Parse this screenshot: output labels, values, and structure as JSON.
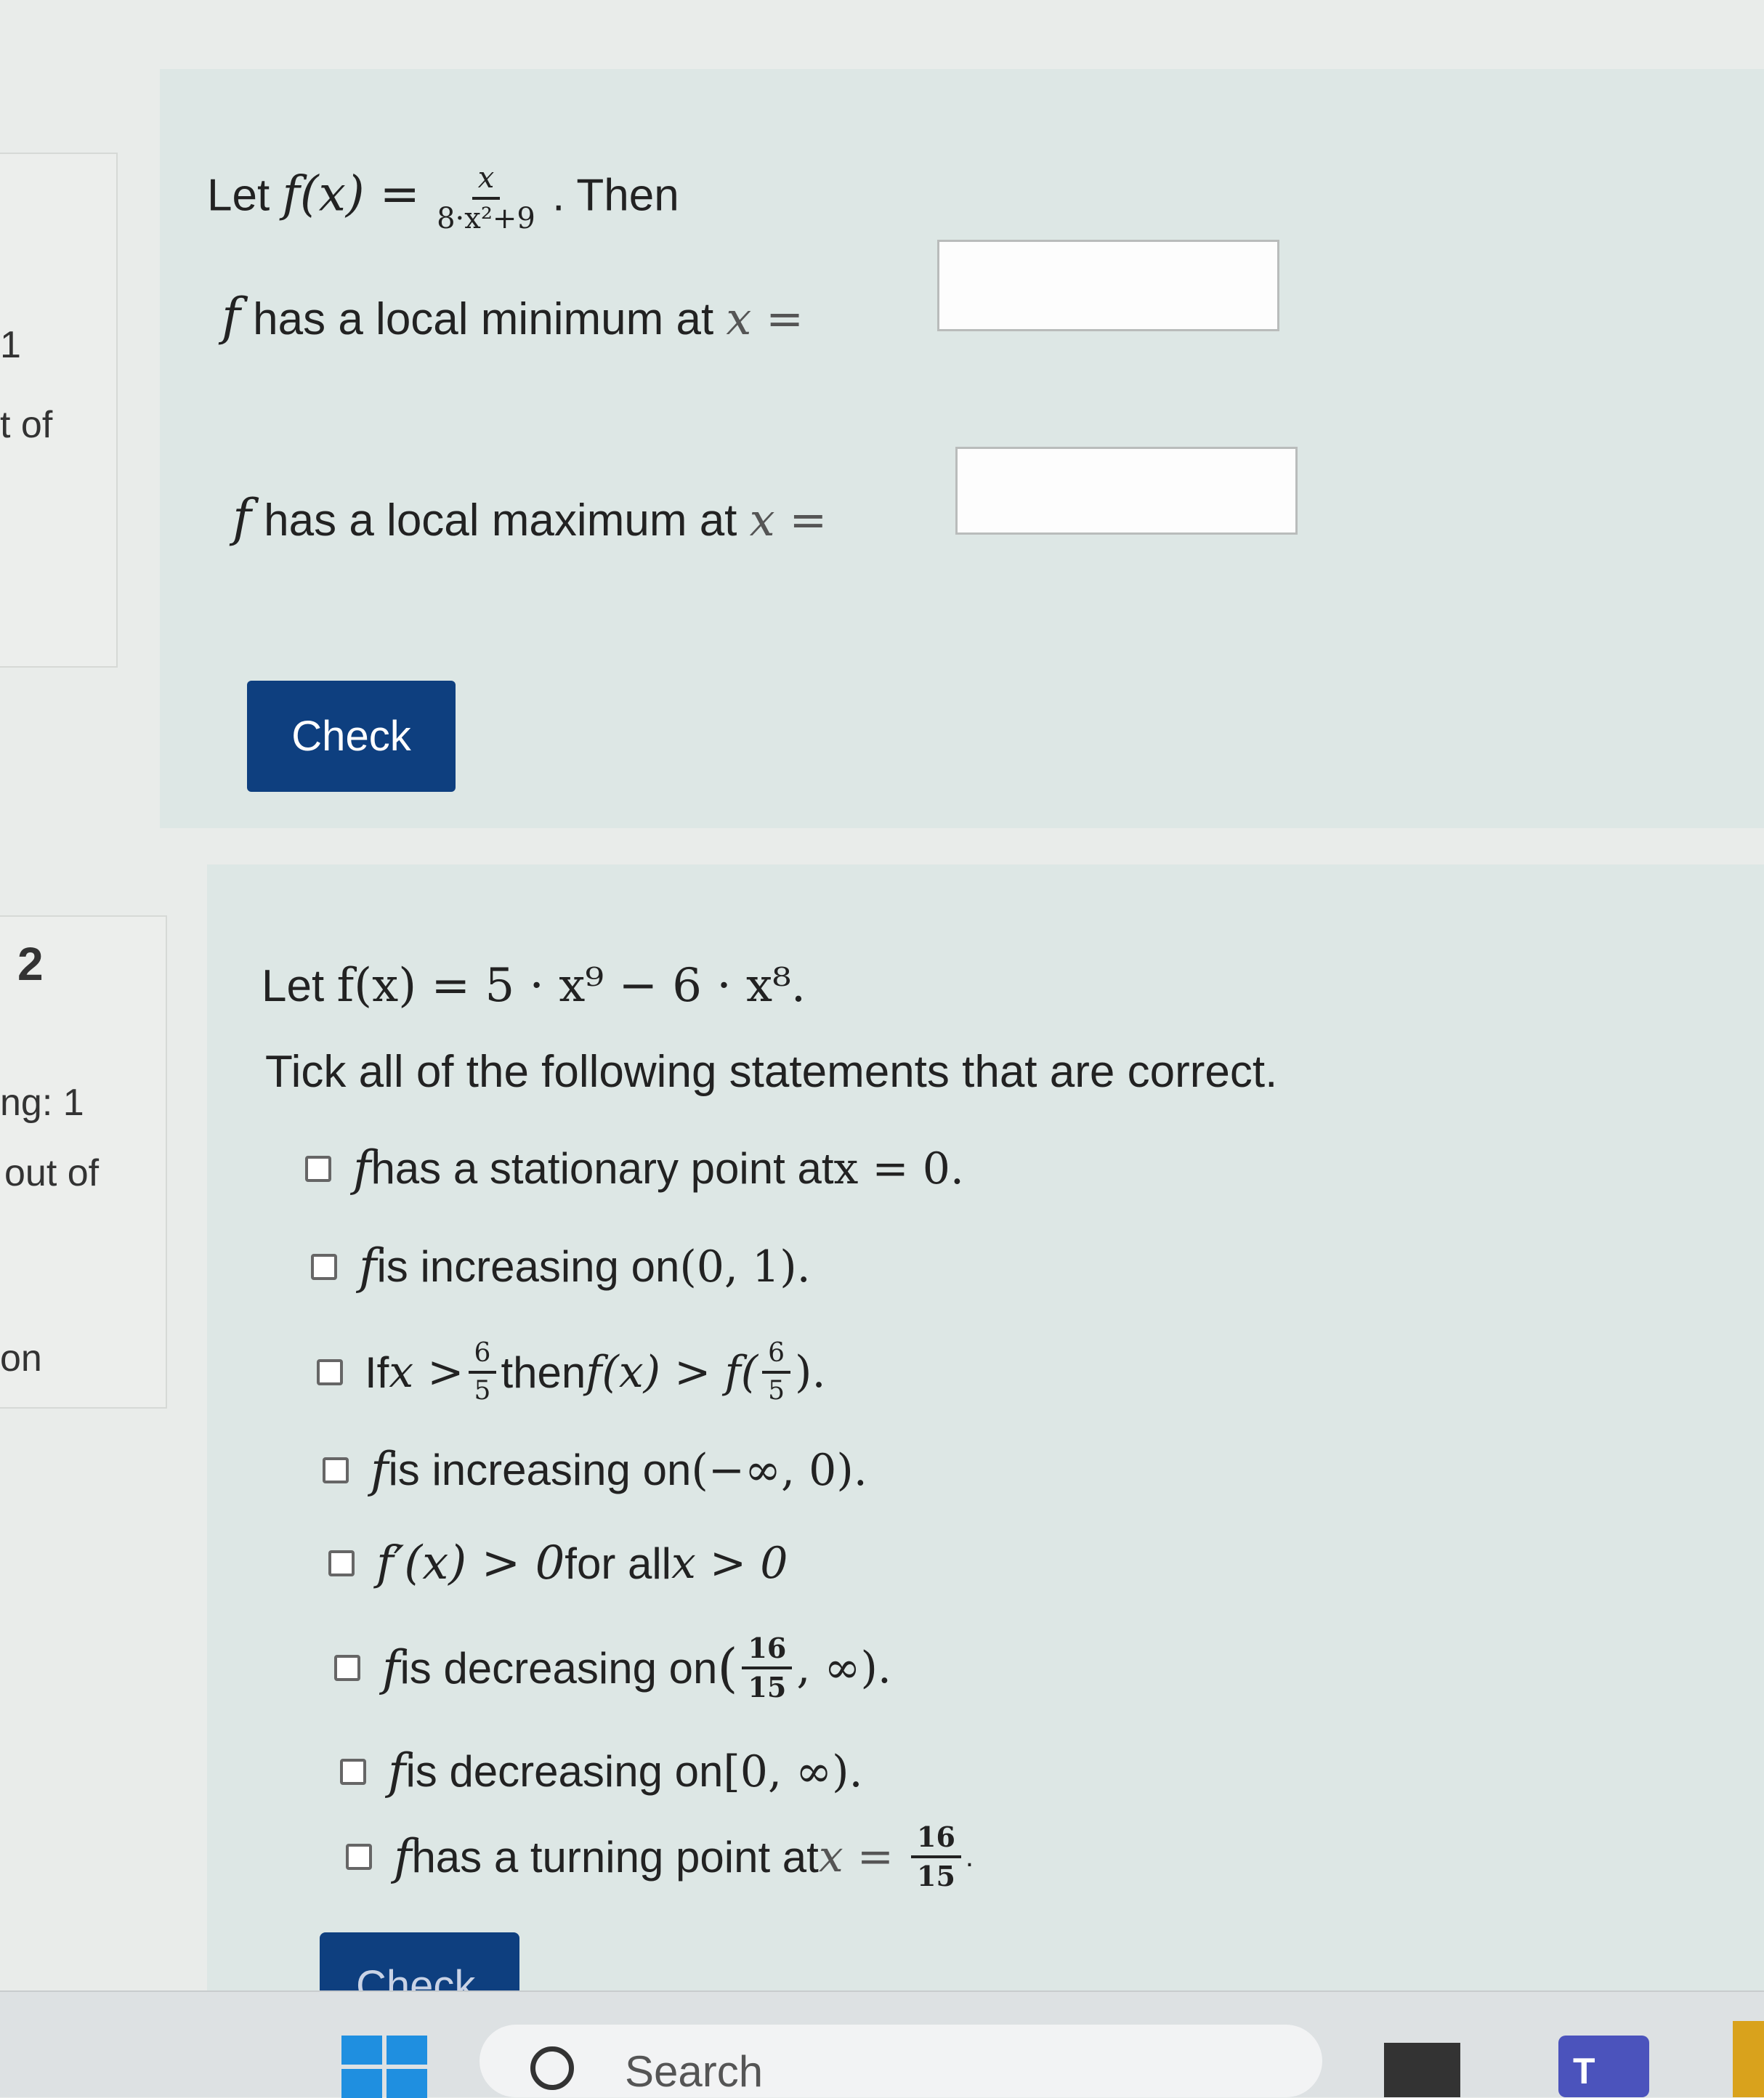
{
  "sidebar": {
    "q1": {
      "number": "1",
      "status": "t of"
    },
    "q2": {
      "number": "2",
      "marking": "ng: 1",
      "points": "out of",
      "action": "on"
    }
  },
  "question1": {
    "prefix": "Let",
    "function_lhs": "f(x) =",
    "fraction": {
      "numerator": "x",
      "denominator": "8·x²+9"
    },
    "suffix": ". Then",
    "min_label": "has a local minimum at",
    "max_label": "has a local maximum at",
    "f_symbol": "f",
    "eq_symbol": "x =",
    "min_value": "",
    "max_value": "",
    "check_label": "Check"
  },
  "question2": {
    "prefix": "Let",
    "function": "f(x) = 5 · x⁹ − 6 · x⁸.",
    "instruction": "Tick all of the following statements that are correct.",
    "options": [
      {
        "pre": "f",
        "text": " has a stationary point at ",
        "math": "x = 0."
      },
      {
        "pre": "f",
        "text": " is increasing on ",
        "math": "(0, 1)."
      },
      {
        "pre": "If ",
        "math1": "x >",
        "frac_num": "6",
        "frac_den": "5",
        "mid": " then ",
        "math2": "f(x) > f(",
        "frac2_num": "6",
        "frac2_den": "5",
        "end": ")."
      },
      {
        "pre": "f",
        "text": " is increasing on ",
        "math": "(−∞, 0)."
      },
      {
        "pre": "f′(x) > 0",
        "text": " for all ",
        "math": "x > 0"
      },
      {
        "pre": "f",
        "text": " is decreasing on ",
        "math_open": "(",
        "frac_num": "16",
        "frac_den": "15",
        "math_close": ", ∞)."
      },
      {
        "pre": "f",
        "text": " is decreasing on ",
        "math": "[0, ∞)."
      },
      {
        "pre": "f",
        "text": " has a turning point at ",
        "math": "x =",
        "frac_num": "16",
        "frac_den": "15",
        "end": "."
      }
    ],
    "check_label": "Check"
  },
  "taskbar": {
    "search_placeholder": "Search",
    "start_icon": "windows-start-icon",
    "search_icon": "search-icon",
    "teams_icon": "teams-icon"
  },
  "colors": {
    "button": "#0e3f7f",
    "card": "#dde7e5",
    "background": "#e9ecea"
  }
}
